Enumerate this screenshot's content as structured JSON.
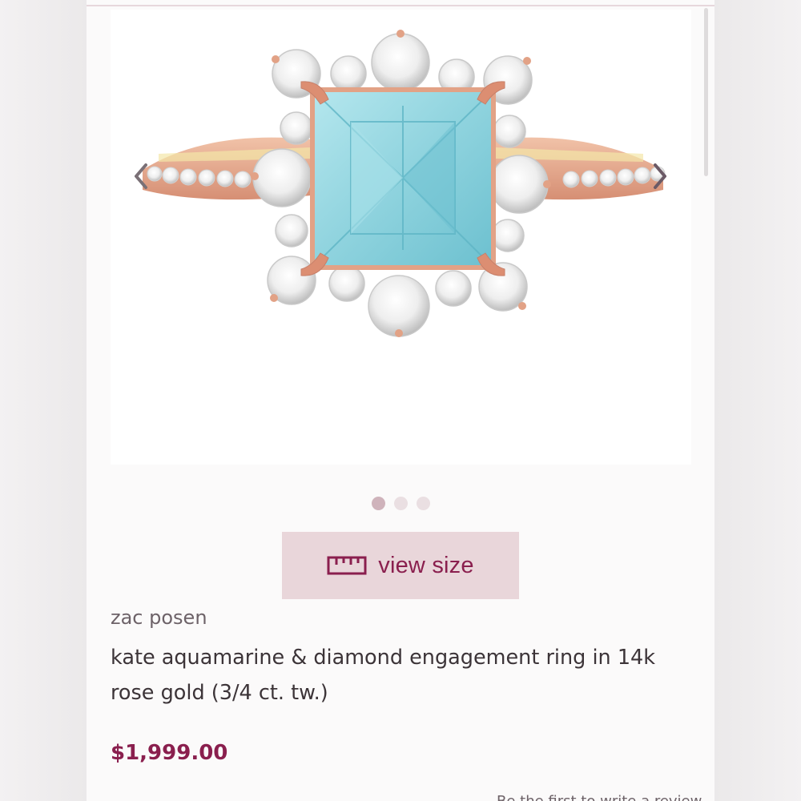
{
  "gallery": {
    "image_alt": "kate aquamarine & diamond engagement ring in 14k rose gold",
    "slide_count": 3,
    "active_slide": 1,
    "colors": {
      "metal": "#e2a286",
      "metal_shadow": "#c7806a",
      "aquamarine": "#8fd3de",
      "aquamarine_dark": "#5fb6c6",
      "diamond": "#f4f4f4",
      "diamond_edge": "#c9c9c9"
    }
  },
  "actions": {
    "view_size_label": "view size",
    "view_size_icon": "ruler-icon"
  },
  "product": {
    "brand": "zac posen",
    "title": "kate aquamarine & diamond engagement ring in 14k rose gold (3/4 ct. tw.)",
    "price": "$1,999.00",
    "review_note": "Be the first to write a review"
  },
  "colors": {
    "accent": "#8a1f4e",
    "button_bg": "#e9d6da",
    "dot_active": "#cfb3bb",
    "dot_inactive": "#eadfe2"
  }
}
